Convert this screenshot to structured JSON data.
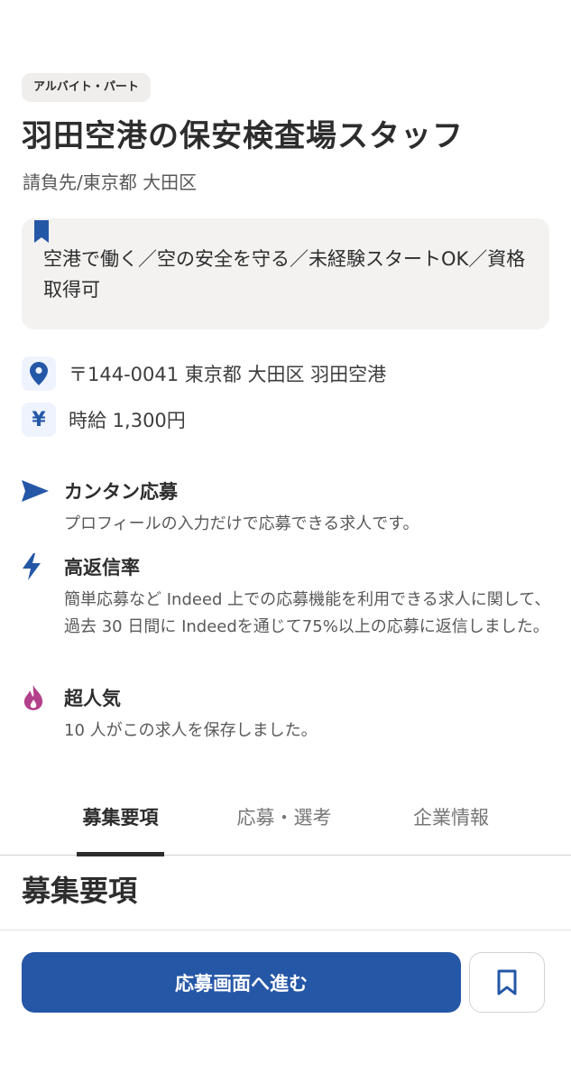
{
  "job": {
    "type_tag": "アルバイト・パート",
    "title": "羽田空港の保安検査場スタッフ",
    "company": "請負先/東京都 大田区",
    "highlight": "空港で働く／空の安全を守る／未経験スタートOK／資格取得可",
    "location": "〒144-0041 東京都 大田区 羽田空港",
    "salary": "時給 1,300円",
    "salary_icon": "¥"
  },
  "features": [
    {
      "icon": "send-icon",
      "title": "カンタン応募",
      "description": "プロフィールの入力だけで応募できる求人です。"
    },
    {
      "icon": "lightning-icon",
      "title": "高返信率",
      "description": "簡単応募など Indeed 上での応募機能を利用できる求人に関して、過去 30 日間に Indeedを通じて75%以上の応募に返信しました。"
    },
    {
      "icon": "fire-icon",
      "title": "超人気",
      "description": "10 人がこの求人を保存しました。"
    }
  ],
  "tabs": [
    {
      "label": "募集要項",
      "active": true
    },
    {
      "label": "応募・選考",
      "active": false
    },
    {
      "label": "企業情報",
      "active": false
    }
  ],
  "section_heading": "募集要項",
  "actions": {
    "apply_label": "応募画面へ進む",
    "save_icon": "bookmark-icon"
  },
  "colors": {
    "accent": "#2557a7",
    "fire": "#b3408a",
    "text": "#2d2d2d"
  }
}
